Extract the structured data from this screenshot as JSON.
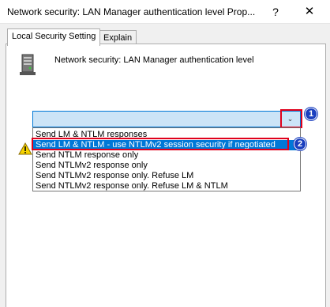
{
  "window": {
    "title": "Network security: LAN Manager authentication level Prop...",
    "help_label": "?",
    "close_label": "✕"
  },
  "tabs": [
    {
      "label": "Local Security Setting",
      "active": true
    },
    {
      "label": "Explain",
      "active": false
    }
  ],
  "policy": {
    "icon": "server-icon",
    "name": "Network security: LAN Manager authentication level"
  },
  "combo": {
    "selected_value": "",
    "arrow": "⌄"
  },
  "dropdown": {
    "options": [
      "Send LM & NTLM responses",
      "Send LM & NTLM - use NTLMv2 session security if negotiated",
      "Send NTLM response only",
      "Send NTLMv2 response only",
      "Send NTLMv2 response only. Refuse LM",
      "Send NTLMv2 response only. Refuse LM & NTLM"
    ],
    "selected_index": 1
  },
  "annotations": {
    "marker_1": "1",
    "marker_2": "2",
    "highlight_color": "#e0001b",
    "marker_color": "#1a3fbf"
  },
  "warning": {
    "icon": "warning-icon"
  }
}
